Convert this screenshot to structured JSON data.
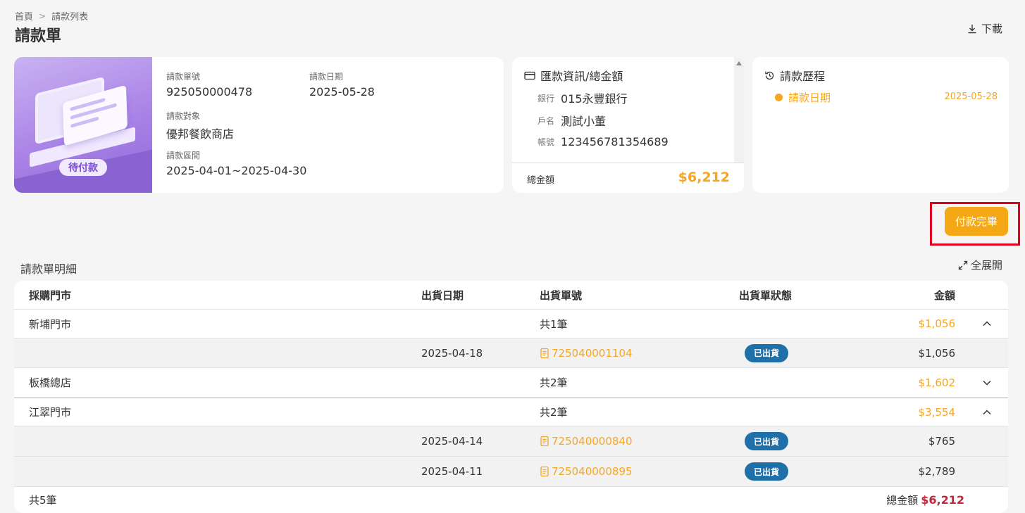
{
  "breadcrumb": {
    "home": "首頁",
    "separator": ">",
    "current": "請款列表"
  },
  "page_title": "請款單",
  "download_label": "下載",
  "invoice": {
    "status_badge": "待付款",
    "number_label": "請款單號",
    "number": "925050000478",
    "date_label": "請款日期",
    "date": "2025-05-28",
    "target_label": "請款對象",
    "target": "優邦餐飲商店",
    "period_label": "請款區間",
    "period": "2025-04-01~2025-04-30"
  },
  "remittance": {
    "title": "匯款資訊/總金額",
    "bank_label": "銀行",
    "bank": "015永豐銀行",
    "account_name_label": "戶名",
    "account_name": "測試小董",
    "account_no_label": "帳號",
    "account_no": "123456781354689",
    "total_label": "總金額",
    "total": "$6,212"
  },
  "history": {
    "title": "請款歷程",
    "items": [
      {
        "label": "請款日期",
        "date": "2025-05-28"
      }
    ]
  },
  "pay_button": "付款完畢",
  "details": {
    "title": "請款單明細",
    "expand_all": "全展開",
    "columns": {
      "store": "採購門市",
      "ship_date": "出貨日期",
      "ship_no": "出貨單號",
      "ship_status": "出貨單狀態",
      "amount": "金額"
    },
    "groups": [
      {
        "store": "新埔門市",
        "count": "共1筆",
        "amount": "$1,056",
        "expanded": true,
        "rows": [
          {
            "date": "2025-04-18",
            "no": "725040001104",
            "status": "已出貨",
            "amount": "$1,056"
          }
        ]
      },
      {
        "store": "板橋總店",
        "count": "共2筆",
        "amount": "$1,602",
        "expanded": false,
        "rows": []
      },
      {
        "store": "江翠門市",
        "count": "共2筆",
        "amount": "$3,554",
        "expanded": true,
        "rows": [
          {
            "date": "2025-04-14",
            "no": "725040000840",
            "status": "已出貨",
            "amount": "$765"
          },
          {
            "date": "2025-04-11",
            "no": "725040000895",
            "status": "已出貨",
            "amount": "$2,789"
          }
        ]
      }
    ],
    "footer": {
      "count": "共5筆",
      "total_label": "總金額",
      "total": "$6,212"
    }
  },
  "colors": {
    "accent": "#f5a623",
    "status_badge": "#1f6fa8",
    "grand_total": "#c0283a",
    "highlight": "#e0001b",
    "illustration": "#a983e6"
  },
  "icons": {
    "download": "download-icon",
    "card": "credit-card-icon",
    "history": "history-icon",
    "expand": "expand-icon",
    "doc": "document-icon",
    "chevron_up": "chevron-up-icon",
    "chevron_down": "chevron-down-icon"
  }
}
